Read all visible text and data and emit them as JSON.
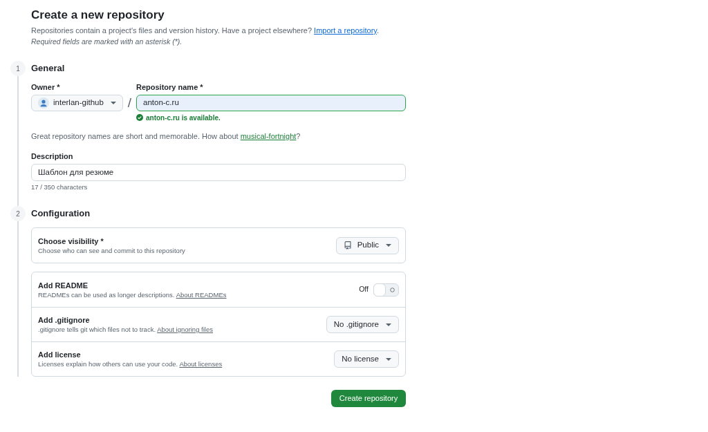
{
  "header": {
    "title": "Create a new repository",
    "intro": {
      "text": "Repositories contain a project's files and version history. Have a project elsewhere?",
      "link": "Import a repository",
      "after": "."
    },
    "required_note": "Required fields are marked with an asterisk (*)."
  },
  "sections": [
    {
      "kind": "general",
      "number": "1",
      "title": "General",
      "owner": {
        "label": "Owner *",
        "value": "interlan-github"
      },
      "separator": "/",
      "repository_name": {
        "label": "Repository name *",
        "value": "anton-c.ru",
        "available": true,
        "message": "anton-c.ru is available."
      },
      "suggestion": {
        "text": "Great repository names are short and memorable. How about",
        "link": "musical-fortnight",
        "after": "?"
      },
      "description": {
        "label": "Description",
        "value": "Шаблон для резюме",
        "counter": "17 / 350 characters"
      }
    },
    {
      "kind": "configuration",
      "number": "2",
      "title": "Configuration",
      "cards": [
        {
          "rows": [
            {
              "title": "Choose visibility *",
              "description": {
                "text": "Choose who can see and commit to this repository"
              },
              "control": {
                "kind": "icon-dropdown",
                "label": "Public"
              }
            }
          ]
        },
        {
          "rows": [
            {
              "title": "Add README",
              "description": {
                "text": "READMEs can be used as longer descriptions.",
                "link": "About READMEs"
              },
              "control": {
                "kind": "toggle",
                "label": "Off",
                "on": false
              }
            },
            {
              "title": "Add .gitignore",
              "description": {
                "text": ".gitignore tells git which files not to track.",
                "link": "About ignoring files"
              },
              "control": {
                "kind": "dropdown",
                "label": "No .gitignore"
              }
            },
            {
              "title": "Add license",
              "description": {
                "text": "Licenses explain how others can use your code.",
                "link": "About licenses"
              },
              "control": {
                "kind": "dropdown",
                "label": "No license"
              }
            }
          ]
        }
      ]
    }
  ],
  "submit": {
    "label": "Create repository"
  }
}
